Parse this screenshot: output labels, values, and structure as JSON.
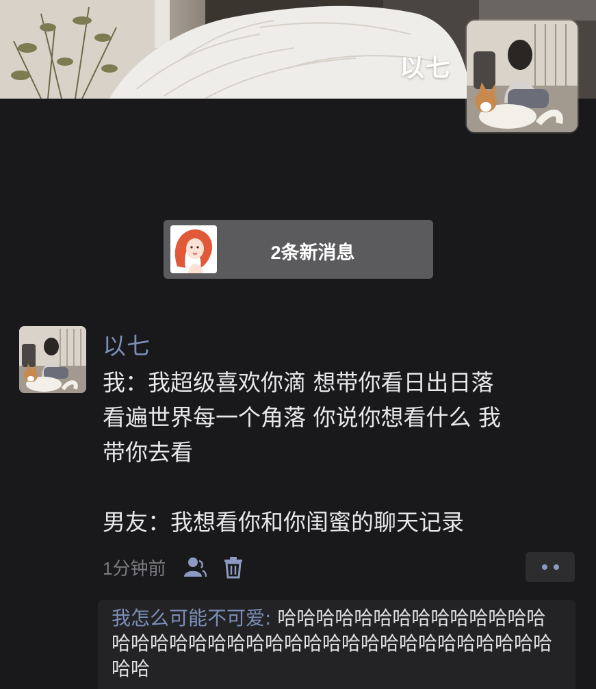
{
  "cover": {
    "user_name": "以七"
  },
  "notification": {
    "text": "2条新消息"
  },
  "post": {
    "author": "以七",
    "lines": [
      "我：我超级喜欢你滴 想带你看日出日落",
      "看遍世界每一个角落 你说你想看什么 我",
      "带你去看",
      "",
      "男友：我想看你和你闺蜜的聊天记录"
    ],
    "time": "1分钟前"
  },
  "comments": [
    {
      "author": "我怎么可能不可爱",
      "separator": ": ",
      "text": "哈哈哈哈哈哈哈哈哈哈哈哈哈哈哈哈哈哈哈哈哈哈哈哈哈哈哈哈哈哈哈哈哈哈哈哈哈哈哈"
    }
  ],
  "colors": {
    "background": "#19191b",
    "link_blue": "#7c8fb8",
    "pill": "#5b5b5e",
    "comment_bg": "#232325"
  },
  "icons": {
    "like": "person-icon",
    "delete": "trash-icon",
    "more": "more-dots-icon"
  }
}
